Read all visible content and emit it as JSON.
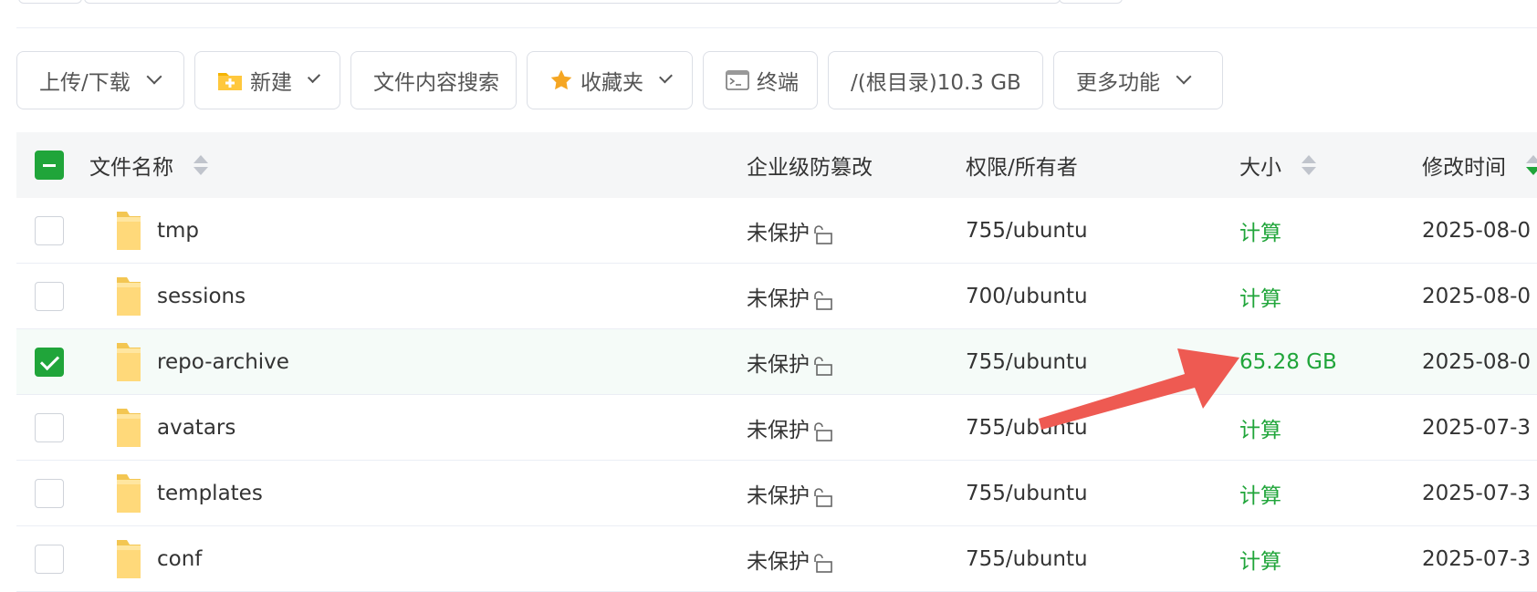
{
  "toolbar": {
    "upload_download": "上传/下载",
    "new": "新建",
    "content_search": "文件内容搜索",
    "favorites": "收藏夹",
    "terminal": "终端",
    "disk_info": "/(根目录)10.3 GB",
    "more": "更多功能"
  },
  "table": {
    "headers": {
      "name": "文件名称",
      "tamper": "企业级防篡改",
      "perm": "权限/所有者",
      "size": "大小",
      "mtime": "修改时间"
    },
    "rows": [
      {
        "name": "tmp",
        "protection": "未保护",
        "perm": "755/ubuntu",
        "size": "计算",
        "mtime": "2025-08-0",
        "selected": false
      },
      {
        "name": "sessions",
        "protection": "未保护",
        "perm": "700/ubuntu",
        "size": "计算",
        "mtime": "2025-08-0",
        "selected": false
      },
      {
        "name": "repo-archive",
        "protection": "未保护",
        "perm": "755/ubuntu",
        "size": "65.28 GB",
        "mtime": "2025-08-0",
        "selected": true
      },
      {
        "name": "avatars",
        "protection": "未保护",
        "perm": "755/ubuntu",
        "size": "计算",
        "mtime": "2025-07-3",
        "selected": false
      },
      {
        "name": "templates",
        "protection": "未保护",
        "perm": "755/ubuntu",
        "size": "计算",
        "mtime": "2025-07-3",
        "selected": false
      },
      {
        "name": "conf",
        "protection": "未保护",
        "perm": "755/ubuntu",
        "size": "计算",
        "mtime": "2025-07-3",
        "selected": false
      }
    ]
  },
  "colors": {
    "accent": "#20a53a",
    "annotation_arrow": "#ee5a52"
  }
}
